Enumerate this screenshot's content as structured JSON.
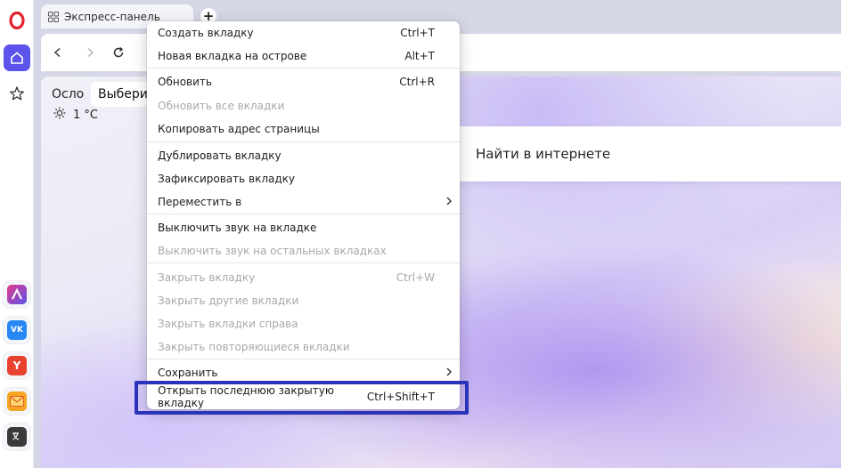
{
  "tab": {
    "title": "Экспресс-панель"
  },
  "new_tab_label": "+",
  "colors": {
    "accent": "#5b53ea",
    "highlight": "#2b33b8"
  },
  "sidebar": {
    "items": [
      {
        "icon": "opera-logo-icon"
      },
      {
        "icon": "home-icon",
        "active": true
      },
      {
        "icon": "bookmarks-star-icon"
      },
      {
        "icon": "aria-app-icon"
      },
      {
        "icon": "vk-app-icon",
        "label": "VK"
      },
      {
        "icon": "yandex-app-icon",
        "label": "Y"
      },
      {
        "icon": "mail-app-icon"
      },
      {
        "icon": "translate-app-icon"
      }
    ]
  },
  "speed_dial": {
    "city": "Осло",
    "choose_label": "Выберит",
    "temperature": "1 °C",
    "search_placeholder": "Найти в интернете"
  },
  "context_menu": {
    "items": [
      {
        "label": "Создать вкладку",
        "shortcut": "Ctrl+T",
        "disabled": false
      },
      {
        "label": "Новая вкладка на острове",
        "shortcut": "Alt+T",
        "disabled": false
      },
      {
        "label": "Обновить",
        "shortcut": "Ctrl+R",
        "disabled": false
      },
      {
        "label": "Обновить все вкладки",
        "shortcut": "",
        "disabled": true
      },
      {
        "label": "Копировать адрес страницы",
        "shortcut": "",
        "disabled": false
      },
      {
        "label": "Дублировать вкладку",
        "shortcut": "",
        "disabled": false
      },
      {
        "label": "Зафиксировать вкладку",
        "shortcut": "",
        "disabled": false
      },
      {
        "label": "Переместить в",
        "shortcut": "",
        "disabled": false,
        "submenu": true
      },
      {
        "label": "Выключить звук на вкладке",
        "shortcut": "",
        "disabled": false
      },
      {
        "label": "Выключить звук на остальных вкладках",
        "shortcut": "",
        "disabled": true
      },
      {
        "label": "Закрыть вкладку",
        "shortcut": "Ctrl+W",
        "disabled": true
      },
      {
        "label": "Закрыть другие вкладки",
        "shortcut": "",
        "disabled": true
      },
      {
        "label": "Закрыть вкладки справа",
        "shortcut": "",
        "disabled": true
      },
      {
        "label": "Закрыть повторяющиеся вкладки",
        "shortcut": "",
        "disabled": true
      },
      {
        "label": "Сохранить",
        "shortcut": "",
        "disabled": false,
        "submenu": true
      },
      {
        "label": "Открыть последнюю закрытую вкладку",
        "shortcut": "Ctrl+Shift+T",
        "disabled": false,
        "highlighted": true
      }
    ]
  }
}
